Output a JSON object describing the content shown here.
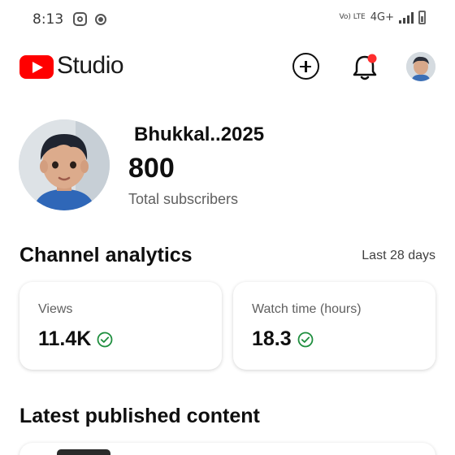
{
  "status_bar": {
    "time": "8:13",
    "network_label": "Vo) LTE",
    "network_type": "4G+",
    "icons": [
      "instagram-icon",
      "cast-icon",
      "signal-icon",
      "battery-icon"
    ]
  },
  "header": {
    "app_name": "Studio",
    "icons": [
      "youtube-logo-icon",
      "create-plus-icon",
      "notification-bell-icon",
      "account-avatar"
    ],
    "notification_badge_color": "#ff2d2d",
    "brand_color": "#ff0000"
  },
  "channel": {
    "name": "Bhukkal..2025",
    "subscriber_count": "800",
    "subscriber_label": "Total subscribers"
  },
  "analytics": {
    "title": "Channel analytics",
    "period": "Last 28 days",
    "cards": [
      {
        "label": "Views",
        "value": "11.4K",
        "status_icon": "check-circle-icon",
        "status_color": "#1e8e3e"
      },
      {
        "label": "Watch time (hours)",
        "value": "18.3",
        "status_icon": "check-circle-icon",
        "status_color": "#1e8e3e"
      }
    ]
  },
  "latest": {
    "title": "Latest published content"
  }
}
